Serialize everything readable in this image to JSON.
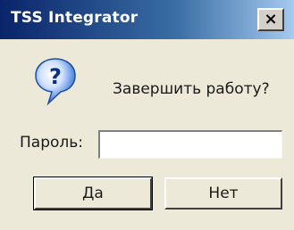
{
  "window": {
    "title": "TSS Integrator",
    "close_glyph": "×"
  },
  "dialog": {
    "icon": "question-icon",
    "message": "Завершить работу?",
    "password_label": "Пароль:",
    "password_value": "",
    "yes_label": "Да",
    "no_label": "Нет"
  },
  "colors": {
    "titlebar_start": "#0a246a",
    "titlebar_end": "#a6caf0",
    "dialog_background": "#ece9d8",
    "icon_blue": "#2f6fd6"
  }
}
